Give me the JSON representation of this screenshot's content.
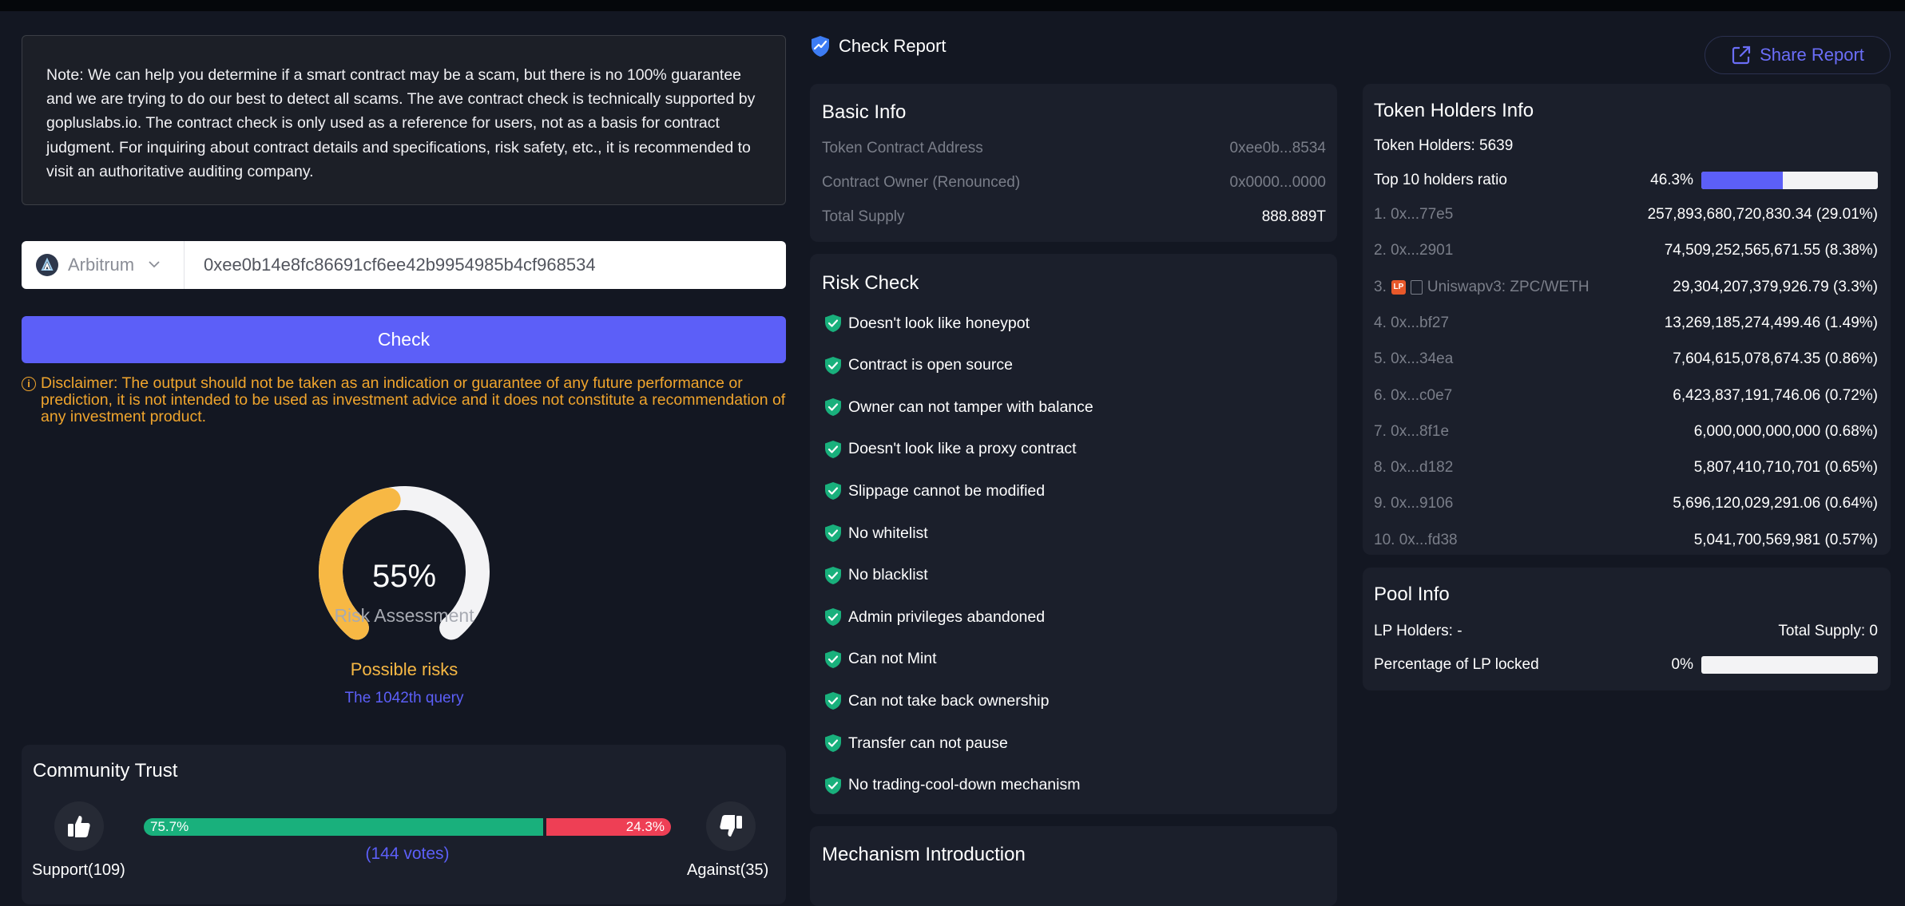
{
  "note": "Note: We can help you determine if a smart contract may be a scam, but there is no 100% guarantee and we are trying to do our best to detect all scams. The ave contract check is technically supported by gopluslabs.io. The contract check is only used as a reference for users, not as a basis for contract judgment. For inquiring about contract details and specifications, risk safety, etc., it is recommended to visit an authoritative auditing company.",
  "search": {
    "chain": "Arbitrum",
    "address": "0xee0b14e8fc86691cf6ee42b9954985b4cf968534",
    "check_label": "Check"
  },
  "disclaimer": "Disclaimer: The output should not be taken as an indication or guarantee of any future performance or prediction, it is not intended to be used as investment advice and it does not constitute a recommendation of any investment product.",
  "gauge": {
    "percent_label": "55%",
    "percent": 55,
    "label": "Risk Assessment",
    "status": "Possible risks",
    "query": "The 1042th query",
    "fill_color": "#f7b844",
    "track_color": "#f3f3f5"
  },
  "community": {
    "title": "Community Trust",
    "support_pct": 75.7,
    "support_pct_label": "75.7%",
    "against_pct_label": "24.3%",
    "votes": "(144 votes)",
    "support_label": "Support(109)",
    "against_label": "Against(35)"
  },
  "report": {
    "title": "Check Report",
    "share_label": "Share Report"
  },
  "basic_info": {
    "title": "Basic Info",
    "rows": [
      {
        "key": "Token Contract Address",
        "value": "0xee0b...8534"
      },
      {
        "key": "Contract Owner (Renounced)",
        "value": "0x0000...0000"
      },
      {
        "key": "Total Supply",
        "value": "888.889T"
      }
    ]
  },
  "risk_check": {
    "title": "Risk Check",
    "items": [
      "Doesn't look like honeypot",
      "Contract is open source",
      "Owner can not tamper with balance",
      "Doesn't look like a proxy contract",
      "Slippage cannot be modified",
      "No whitelist",
      "No blacklist",
      "Admin privileges abandoned",
      "Can not Mint",
      "Can not take back ownership",
      "Transfer can not pause",
      "No trading-cool-down mechanism"
    ]
  },
  "mechanism": {
    "title": "Mechanism Introduction"
  },
  "holders": {
    "title": "Token Holders Info",
    "count_label": "Token Holders: 5639",
    "top10_label": "Top 10 holders ratio",
    "top10_pct_label": "46.3%",
    "top10_pct": 46.3,
    "list": [
      {
        "name": "1. 0x...77e5",
        "value": "257,893,680,720,830.34 (29.01%)"
      },
      {
        "name": "2. 0x...2901",
        "value": "74,509,252,565,671.55 (8.38%)"
      },
      {
        "name": "3.",
        "tag": "LP",
        "label": "Uniswapv3: ZPC/WETH",
        "value": "29,304,207,379,926.79 (3.3%)"
      },
      {
        "name": "4. 0x...bf27",
        "value": "13,269,185,274,499.46 (1.49%)"
      },
      {
        "name": "5. 0x...34ea",
        "value": "7,604,615,078,674.35 (0.86%)"
      },
      {
        "name": "6. 0x...c0e7",
        "value": "6,423,837,191,746.06 (0.72%)"
      },
      {
        "name": "7. 0x...8f1e",
        "value": "6,000,000,000,000 (0.68%)"
      },
      {
        "name": "8. 0x...d182",
        "value": "5,807,410,710,701 (0.65%)"
      },
      {
        "name": "9. 0x...9106",
        "value": "5,696,120,029,291.06 (0.64%)"
      },
      {
        "name": "10. 0x...fd38",
        "value": "5,041,700,569,981 (0.57%)"
      }
    ]
  },
  "pool": {
    "title": "Pool Info",
    "lp_holders": "LP Holders: -",
    "total_supply": "Total Supply: 0",
    "locked_label": "Percentage of LP locked",
    "locked_pct_label": "0%",
    "locked_pct": 0
  },
  "colors": {
    "accent": "#5c5ff8",
    "warning": "#f0a52d",
    "success": "#19b07c",
    "danger": "#ee3f55"
  }
}
